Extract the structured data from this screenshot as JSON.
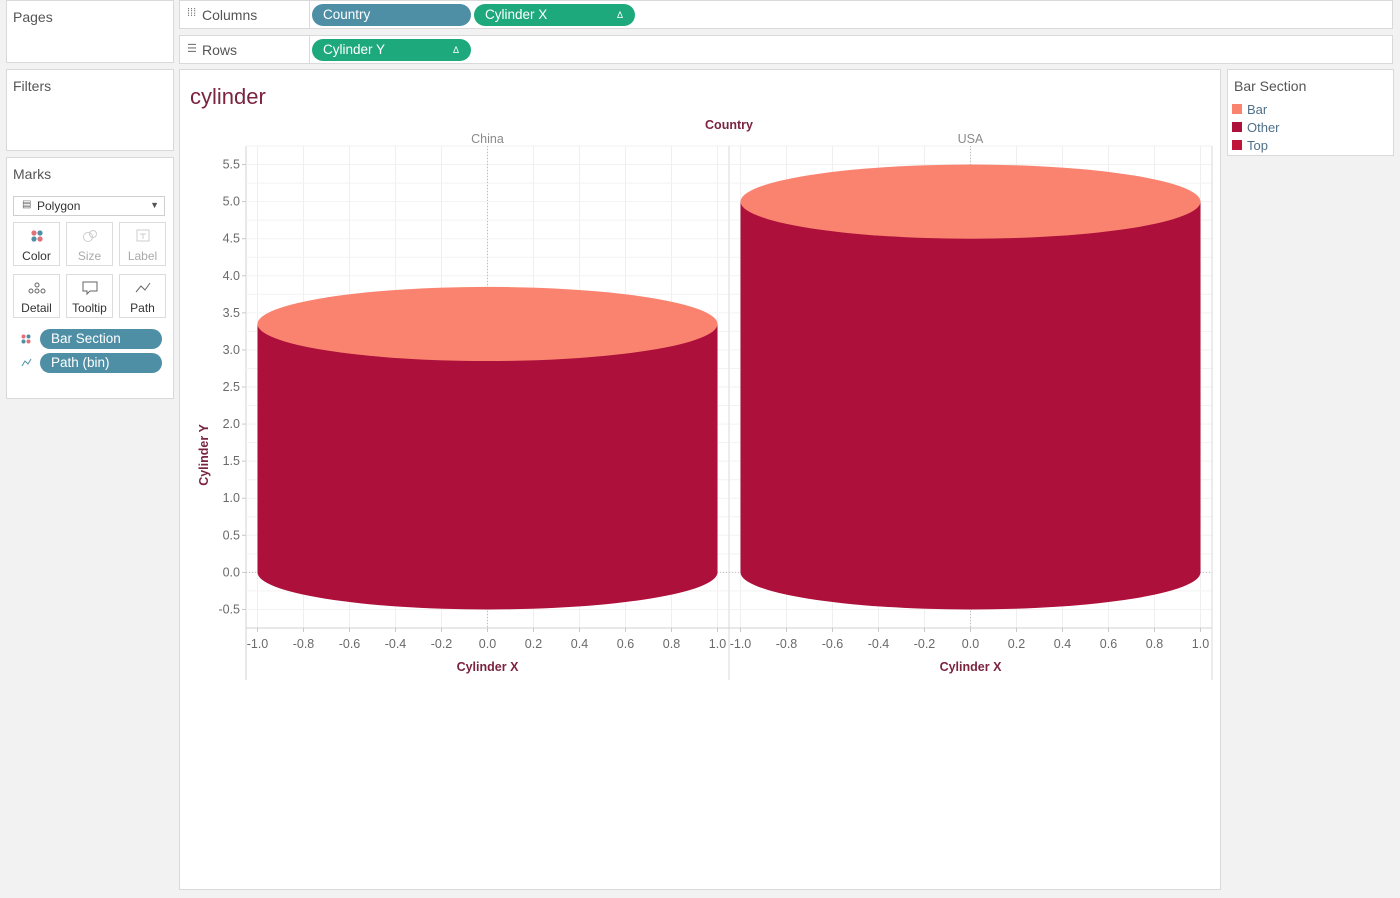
{
  "pages": {
    "title": "Pages"
  },
  "filters": {
    "title": "Filters"
  },
  "columns": {
    "label": "Columns",
    "pills": [
      {
        "label": "Country"
      },
      {
        "label": "Cylinder X",
        "delta": "Δ"
      }
    ]
  },
  "rows": {
    "label": "Rows",
    "pills": [
      {
        "label": "Cylinder Y",
        "delta": "Δ"
      }
    ]
  },
  "marks": {
    "title": "Marks",
    "mark_type": "Polygon",
    "buttons": [
      {
        "label": "Color",
        "icon": "color-dots-icon"
      },
      {
        "label": "Size",
        "icon": "size-icon"
      },
      {
        "label": "Label",
        "icon": "label-icon"
      },
      {
        "label": "Detail",
        "icon": "detail-icon"
      },
      {
        "label": "Tooltip",
        "icon": "tooltip-icon"
      },
      {
        "label": "Path",
        "icon": "path-icon"
      }
    ],
    "fields": [
      {
        "label": "Bar Section",
        "icon": "color-dots-icon"
      },
      {
        "label": "Path (bin)",
        "icon": "path-icon"
      }
    ]
  },
  "legend": {
    "title": "Bar Section",
    "items": [
      {
        "label": "Bar",
        "color": "#fa8370"
      },
      {
        "label": "Other",
        "color": "#ad103b"
      },
      {
        "label": "Top",
        "color": "#c0143a"
      }
    ]
  },
  "view": {
    "title": "cylinder"
  },
  "chart_data": {
    "type": "polygon",
    "title": "cylinder",
    "column_header": "Country",
    "xlabel": "Cylinder X",
    "ylabel": "Cylinder Y",
    "xlim": [
      -1.05,
      1.05
    ],
    "ylim": [
      -0.75,
      5.75
    ],
    "x_ticks": [
      "-1.0",
      "-0.8",
      "-0.6",
      "-0.4",
      "-0.2",
      "0.0",
      "0.2",
      "0.4",
      "0.6",
      "0.8",
      "1.0"
    ],
    "y_ticks": [
      "5.5",
      "5.0",
      "4.5",
      "4.0",
      "3.5",
      "3.0",
      "2.5",
      "2.0",
      "1.5",
      "1.0",
      "0.5",
      "0.0",
      "-0.5"
    ],
    "grid": true,
    "colors": {
      "top": "#fa8370",
      "body": "#ad103b"
    },
    "panels": [
      {
        "country": "China",
        "base_y": 0.0,
        "top_y": 3.35,
        "ellipse_half_height": 0.5,
        "x_radius": 1.0
      },
      {
        "country": "USA",
        "base_y": 0.0,
        "top_y": 5.0,
        "ellipse_half_height": 0.5,
        "x_radius": 1.0
      }
    ]
  }
}
